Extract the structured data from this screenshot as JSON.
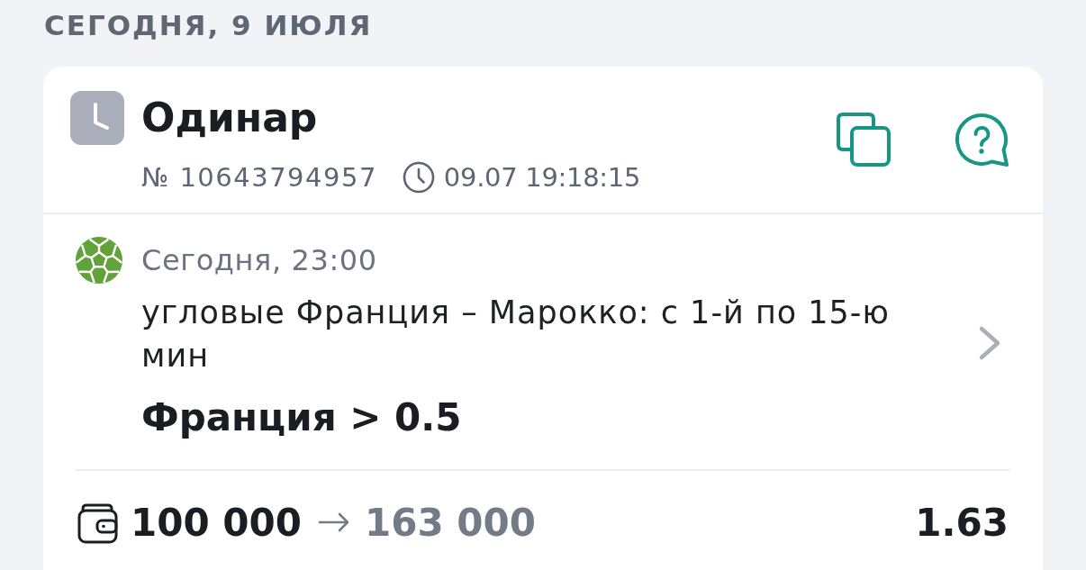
{
  "day_heading": "СЕГОДНЯ, 9 ИЮЛЯ",
  "bet": {
    "type": "Одинар",
    "number": "№ 10643794957",
    "placed_at": "09.07 19:18:15",
    "event": {
      "start": "Сегодня, 23:00",
      "market": "угловые Франция – Марокко: с 1-й по 15-ю мин",
      "selection": "Франция > 0.5"
    },
    "stake": "100 000",
    "payout": "163 000",
    "odds": "1.63"
  }
}
